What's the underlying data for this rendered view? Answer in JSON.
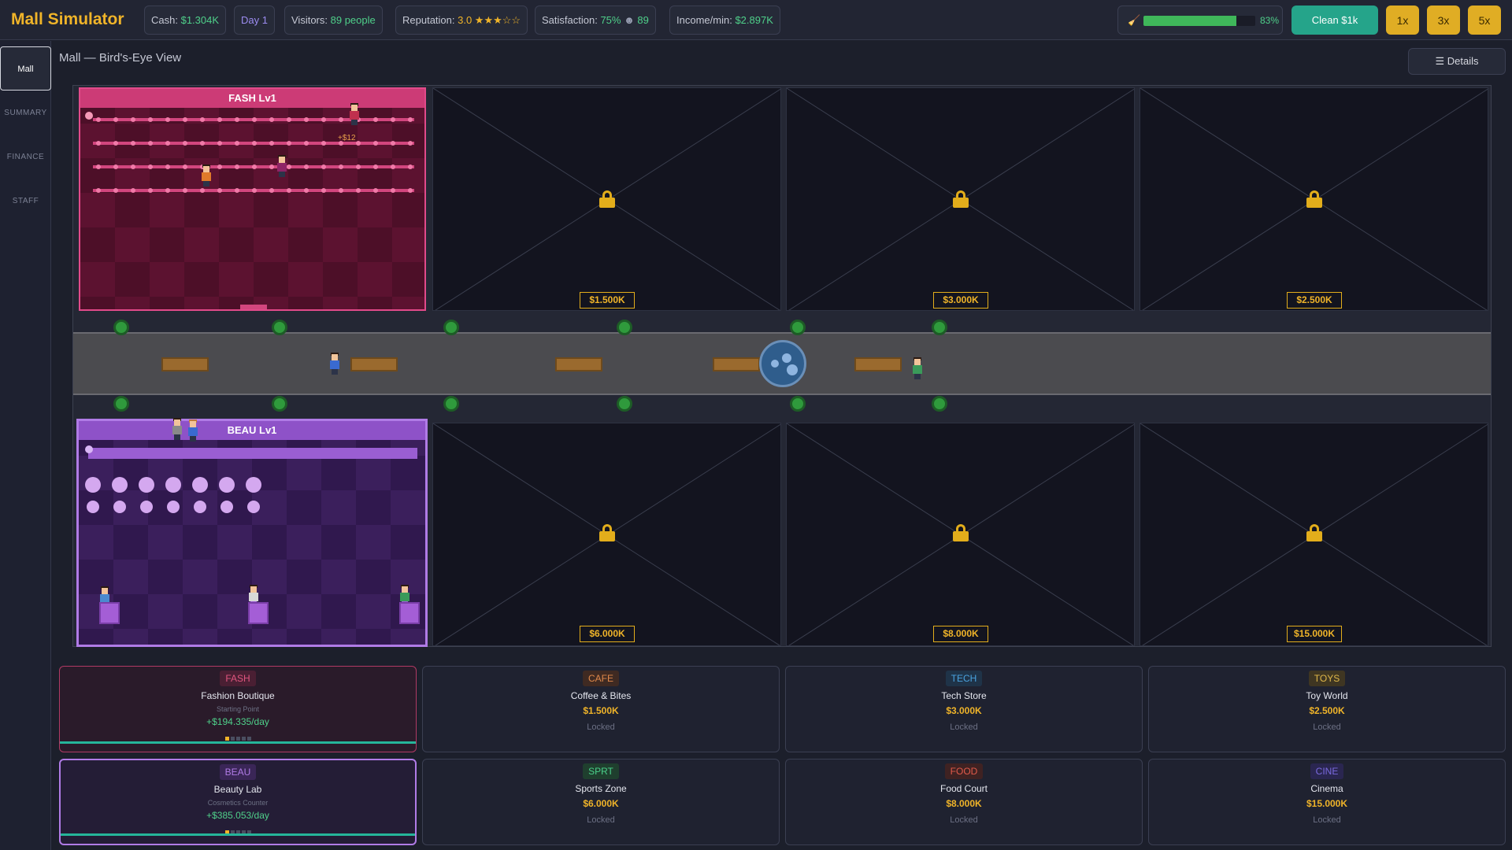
{
  "header": {
    "title": "Mall Simulator",
    "cash_label": "Cash:",
    "cash_value": "$1.304K",
    "day": "Day 1",
    "visitors_label": "Visitors:",
    "visitors_value": "89 people",
    "reputation_label": "Reputation:",
    "reputation_value": "3.0 ★★★☆☆",
    "satisfaction_label": "Satisfaction:",
    "satisfaction_value": "75%",
    "satisfaction_count": "89",
    "income_label": "Income/min:",
    "income_value": "$2.897K",
    "cleanliness_percent": 83,
    "cleanliness_label": "83%",
    "clean_button": "Clean  $1k",
    "speeds": [
      "1x",
      "3x",
      "5x"
    ]
  },
  "sidebar": {
    "items": [
      "Mall",
      "SUMMARY",
      "FINANCE",
      "STAFF"
    ],
    "active": "Mall"
  },
  "view": {
    "title": "Mall — Bird's-Eye View",
    "details_button": "☰  Details"
  },
  "mall": {
    "owned_stores": [
      {
        "id": "fash",
        "header": "FASH Lv1",
        "floating_income": "+$12"
      },
      {
        "id": "beau",
        "header": "BEAU Lv1"
      }
    ],
    "locked_slots": [
      {
        "price": "$1.500K"
      },
      {
        "price": "$3.000K"
      },
      {
        "price": "$2.500K"
      },
      {
        "price": "$6.000K"
      },
      {
        "price": "$8.000K"
      },
      {
        "price": "$15.000K"
      }
    ]
  },
  "cards": [
    {
      "tag": "FASH",
      "name": "Fashion Boutique",
      "sub": "Starting Point",
      "income": "+$194.335/day",
      "owned": true,
      "level": 1,
      "tag_color": "#e0557f",
      "tag_bg": "#4a1f33"
    },
    {
      "tag": "CAFE",
      "name": "Coffee & Bites",
      "price": "$1.500K",
      "status": "Locked",
      "tag_color": "#e0884a",
      "tag_bg": "#3f2a22"
    },
    {
      "tag": "TECH",
      "name": "Tech Store",
      "price": "$3.000K",
      "status": "Locked",
      "tag_color": "#4aa3e0",
      "tag_bg": "#1f3348"
    },
    {
      "tag": "TOYS",
      "name": "Toy World",
      "price": "$2.500K",
      "status": "Locked",
      "tag_color": "#e0b84a",
      "tag_bg": "#3f3622"
    },
    {
      "tag": "BEAU",
      "name": "Beauty Lab",
      "sub": "Cosmetics Counter",
      "income": "+$385.053/day",
      "owned": true,
      "level": 1,
      "tag_color": "#b07be6",
      "tag_bg": "#3a2657"
    },
    {
      "tag": "SPRT",
      "name": "Sports Zone",
      "price": "$6.000K",
      "status": "Locked",
      "tag_color": "#4ad08a",
      "tag_bg": "#1f3f2e"
    },
    {
      "tag": "FOOD",
      "name": "Food Court",
      "price": "$8.000K",
      "status": "Locked",
      "tag_color": "#e05a4a",
      "tag_bg": "#3f2222"
    },
    {
      "tag": "CINE",
      "name": "Cinema",
      "price": "$15.000K",
      "status": "Locked",
      "tag_color": "#7a6ae0",
      "tag_bg": "#2a2650"
    }
  ]
}
